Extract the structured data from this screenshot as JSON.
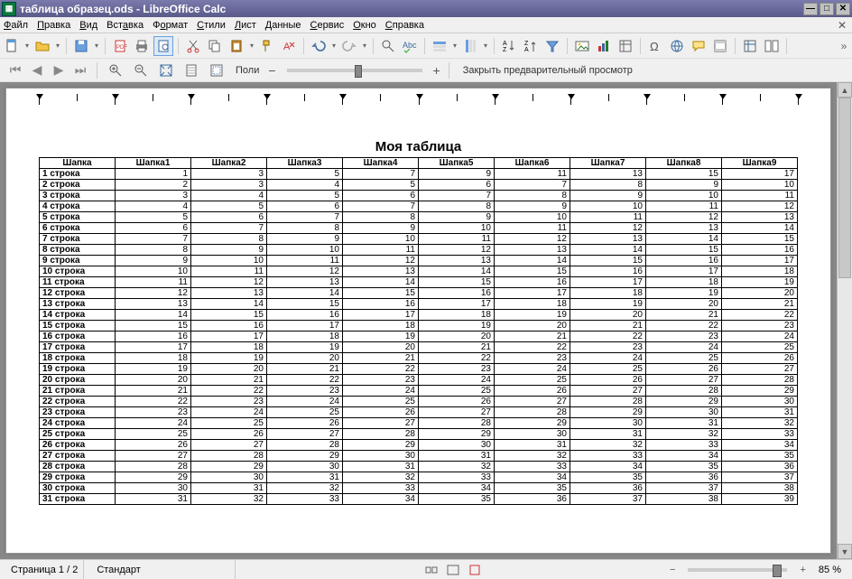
{
  "title": "таблица образец.ods - LibreOffice Calc",
  "menu": {
    "close_icon": "✕",
    "items": [
      "Файл",
      "Правка",
      "Вид",
      "Вставка",
      "Формат",
      "Стили",
      "Лист",
      "Данные",
      "Сервис",
      "Окно",
      "Справка"
    ],
    "u": [
      0,
      0,
      0,
      3,
      1,
      0,
      0,
      0,
      0,
      0,
      0
    ]
  },
  "nav": {
    "copies_label": "Поли",
    "close_preview": "Закрыть предварительный просмотр"
  },
  "chart_data": {
    "type": "table",
    "title": "Моя таблица",
    "headers": [
      "Шапка",
      "Шапка1",
      "Шапка2",
      "Шапка3",
      "Шапка4",
      "Шапка5",
      "Шапка6",
      "Шапка7",
      "Шапка8",
      "Шапка9"
    ],
    "rows": [
      {
        "label": "1 строка",
        "values": [
          1,
          3,
          5,
          7,
          9,
          11,
          13,
          15,
          17
        ]
      },
      {
        "label": "2 строка",
        "values": [
          2,
          3,
          4,
          5,
          6,
          7,
          8,
          9,
          10
        ]
      },
      {
        "label": "3 строка",
        "values": [
          3,
          4,
          5,
          6,
          7,
          8,
          9,
          10,
          11
        ]
      },
      {
        "label": "4 строка",
        "values": [
          4,
          5,
          6,
          7,
          8,
          9,
          10,
          11,
          12
        ]
      },
      {
        "label": "5 строка",
        "values": [
          5,
          6,
          7,
          8,
          9,
          10,
          11,
          12,
          13
        ]
      },
      {
        "label": "6 строка",
        "values": [
          6,
          7,
          8,
          9,
          10,
          11,
          12,
          13,
          14
        ]
      },
      {
        "label": "7 строка",
        "values": [
          7,
          8,
          9,
          10,
          11,
          12,
          13,
          14,
          15
        ]
      },
      {
        "label": "8 строка",
        "values": [
          8,
          9,
          10,
          11,
          12,
          13,
          14,
          15,
          16
        ]
      },
      {
        "label": "9 строка",
        "values": [
          9,
          10,
          11,
          12,
          13,
          14,
          15,
          16,
          17
        ]
      },
      {
        "label": "10 строка",
        "values": [
          10,
          11,
          12,
          13,
          14,
          15,
          16,
          17,
          18
        ]
      },
      {
        "label": "11 строка",
        "values": [
          11,
          12,
          13,
          14,
          15,
          16,
          17,
          18,
          19
        ]
      },
      {
        "label": "12 строка",
        "values": [
          12,
          13,
          14,
          15,
          16,
          17,
          18,
          19,
          20
        ]
      },
      {
        "label": "13 строка",
        "values": [
          13,
          14,
          15,
          16,
          17,
          18,
          19,
          20,
          21
        ]
      },
      {
        "label": "14 строка",
        "values": [
          14,
          15,
          16,
          17,
          18,
          19,
          20,
          21,
          22
        ]
      },
      {
        "label": "15 строка",
        "values": [
          15,
          16,
          17,
          18,
          19,
          20,
          21,
          22,
          23
        ]
      },
      {
        "label": "16 строка",
        "values": [
          16,
          17,
          18,
          19,
          20,
          21,
          22,
          23,
          24
        ]
      },
      {
        "label": "17 строка",
        "values": [
          17,
          18,
          19,
          20,
          21,
          22,
          23,
          24,
          25
        ]
      },
      {
        "label": "18 строка",
        "values": [
          18,
          19,
          20,
          21,
          22,
          23,
          24,
          25,
          26
        ]
      },
      {
        "label": "19 строка",
        "values": [
          19,
          20,
          21,
          22,
          23,
          24,
          25,
          26,
          27
        ]
      },
      {
        "label": "20 строка",
        "values": [
          20,
          21,
          22,
          23,
          24,
          25,
          26,
          27,
          28
        ]
      },
      {
        "label": "21 строка",
        "values": [
          21,
          22,
          23,
          24,
          25,
          26,
          27,
          28,
          29
        ]
      },
      {
        "label": "22 строка",
        "values": [
          22,
          23,
          24,
          25,
          26,
          27,
          28,
          29,
          30
        ]
      },
      {
        "label": "23 строка",
        "values": [
          23,
          24,
          25,
          26,
          27,
          28,
          29,
          30,
          31
        ]
      },
      {
        "label": "24 строка",
        "values": [
          24,
          25,
          26,
          27,
          28,
          29,
          30,
          31,
          32
        ]
      },
      {
        "label": "25 строка",
        "values": [
          25,
          26,
          27,
          28,
          29,
          30,
          31,
          32,
          33
        ]
      },
      {
        "label": "26 строка",
        "values": [
          26,
          27,
          28,
          29,
          30,
          31,
          32,
          33,
          34
        ]
      },
      {
        "label": "27 строка",
        "values": [
          27,
          28,
          29,
          30,
          31,
          32,
          33,
          34,
          35
        ]
      },
      {
        "label": "28 строка",
        "values": [
          28,
          29,
          30,
          31,
          32,
          33,
          34,
          35,
          36
        ]
      },
      {
        "label": "29 строка",
        "values": [
          29,
          30,
          31,
          32,
          33,
          34,
          35,
          36,
          37
        ]
      },
      {
        "label": "30 строка",
        "values": [
          30,
          31,
          32,
          33,
          34,
          35,
          36,
          37,
          38
        ]
      },
      {
        "label": "31 строка",
        "values": [
          31,
          32,
          33,
          34,
          35,
          36,
          37,
          38,
          39
        ]
      }
    ]
  },
  "status": {
    "page": "Страница 1 / 2",
    "style": "Стандарт",
    "zoom": "85 %"
  }
}
